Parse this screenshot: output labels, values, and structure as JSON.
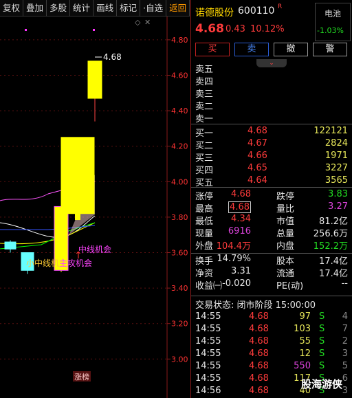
{
  "toolbar": {
    "items": [
      "复权",
      "叠加",
      "多股",
      "统计",
      "画线",
      "标记",
      "·自选",
      "返回"
    ]
  },
  "axis": {
    "ticks": [
      "4.80",
      "4.60",
      "4.40",
      "4.20",
      "4.00",
      "3.80",
      "3.60",
      "3.40",
      "3.20",
      "3.00"
    ],
    "min": 2.95,
    "max": 4.85
  },
  "chart": {
    "high_label": "4.68",
    "signals": [
      "小中线机会",
      "主攻机会",
      "中线机会"
    ],
    "bottom_tag": "涨榜"
  },
  "candles": [
    {
      "o": 3.62,
      "c": 3.66,
      "h": 3.67,
      "l": 3.6,
      "color": "cyan"
    },
    {
      "o": 3.6,
      "c": 3.5,
      "h": 3.6,
      "l": 3.48,
      "color": "cyan"
    },
    {
      "o": 3.5,
      "c": 3.86,
      "h": 3.87,
      "l": 3.49,
      "color": "yellow"
    },
    {
      "o": 3.82,
      "c": 4.25,
      "h": 4.25,
      "l": 3.8,
      "color": "yellow"
    },
    {
      "o": 4.47,
      "c": 4.68,
      "h": 4.68,
      "l": 4.34,
      "color": "yellow"
    }
  ],
  "header": {
    "name": "诺德股份",
    "code": "600110",
    "badge": "R",
    "sector": "电池",
    "sector_chg": "-1.03%",
    "price": "4.68",
    "change": "0.43",
    "pct": "10.12%"
  },
  "buttons": {
    "buy": "买",
    "sell": "卖",
    "cancel": "撤",
    "alert": "警"
  },
  "asks": [
    "卖五",
    "卖四",
    "卖三",
    "卖二",
    "卖一"
  ],
  "bids": [
    {
      "l": "买一",
      "p": "4.68",
      "v": "122121"
    },
    {
      "l": "买二",
      "p": "4.67",
      "v": "2824"
    },
    {
      "l": "买三",
      "p": "4.66",
      "v": "1971"
    },
    {
      "l": "买四",
      "p": "4.65",
      "v": "3227"
    },
    {
      "l": "买五",
      "p": "4.64",
      "v": "3565"
    }
  ],
  "stats": {
    "zt_l": "涨停",
    "zt": "4.68",
    "dt_l": "跌停",
    "dt": "3.83",
    "gao_l": "最高",
    "gao": "4.68",
    "lb_l": "量比",
    "lb": "3.27",
    "di_l": "最低",
    "di": "4.34",
    "sz_l": "市值",
    "sz": "81.2亿",
    "xl_l": "现量",
    "xl": "6916",
    "zl_l": "总量",
    "zl": "256.6万",
    "wp_l": "外盘",
    "wp": "104.4万",
    "np_l": "内盘",
    "np": "152.2万",
    "hs_l": "换手",
    "hs": "14.79%",
    "gb_l": "股本",
    "gb": "17.4亿",
    "jz_l": "净资",
    "jz": "3.31",
    "lt_l": "流通",
    "lt": "17.4亿",
    "sy_l": "收益㈠",
    "sy": "-0.020",
    "pe_l": "PE(动)",
    "pe": "--"
  },
  "status": "交易状态: 闭市阶段 15:00:00",
  "ticks": [
    {
      "t": "14:55",
      "p": "4.68",
      "v": "97",
      "s": "S",
      "n": "4",
      "vc": "yel"
    },
    {
      "t": "14:55",
      "p": "4.68",
      "v": "103",
      "s": "S",
      "n": "7",
      "vc": "yel"
    },
    {
      "t": "14:55",
      "p": "4.68",
      "v": "55",
      "s": "S",
      "n": "2",
      "vc": "yel"
    },
    {
      "t": "14:55",
      "p": "4.68",
      "v": "12",
      "s": "S",
      "n": "3",
      "vc": "yel"
    },
    {
      "t": "14:55",
      "p": "4.68",
      "v": "550",
      "s": "S",
      "n": "5",
      "vc": "mag"
    },
    {
      "t": "14:55",
      "p": "4.68",
      "v": "117",
      "s": "S",
      "n": "6",
      "vc": "yel"
    },
    {
      "t": "14:56",
      "p": "4.68",
      "v": "40",
      "s": "S",
      "n": "3",
      "vc": "yel"
    }
  ],
  "watermark": "股海游侠"
}
